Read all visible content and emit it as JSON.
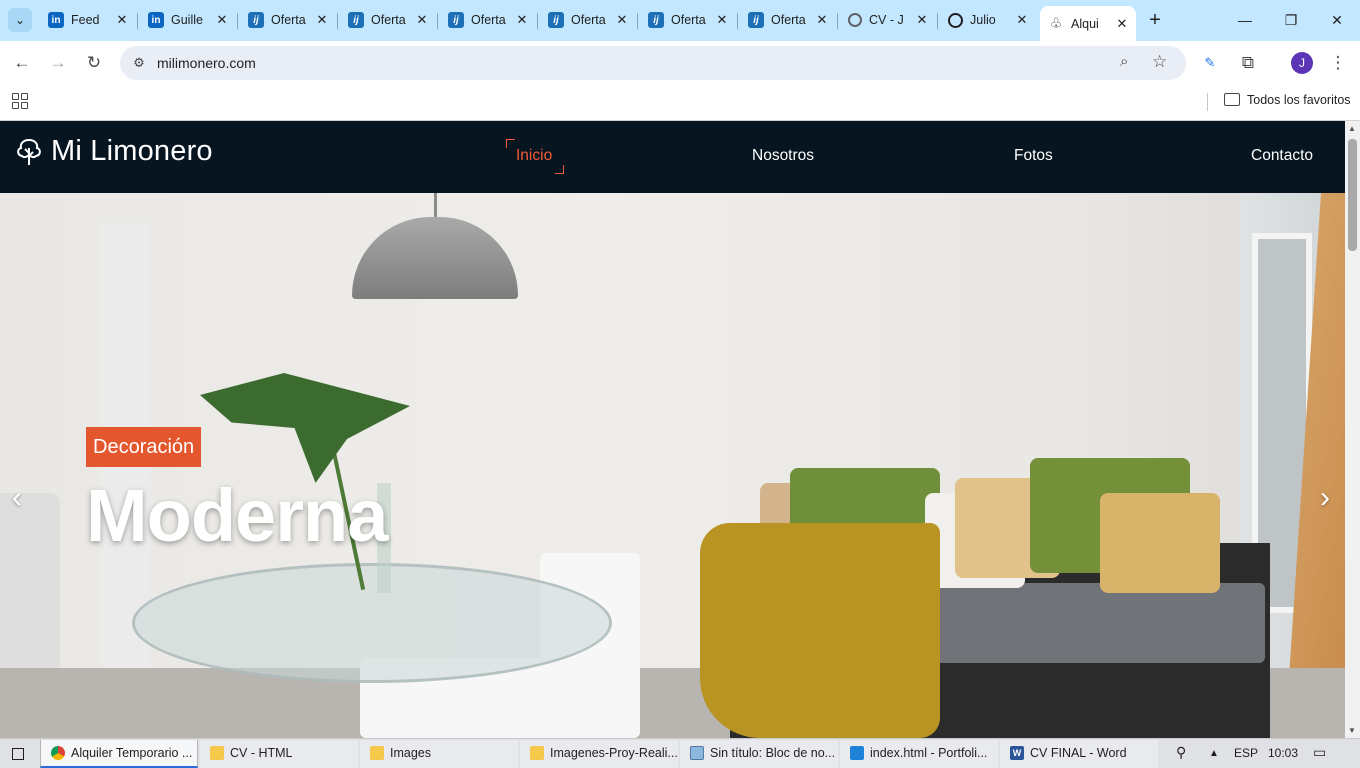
{
  "browser": {
    "tabs": [
      {
        "label": "Feed",
        "icon": "linkedin-icon"
      },
      {
        "label": "Guille",
        "icon": "linkedin-icon"
      },
      {
        "label": "Oferta",
        "icon": "infojobs-icon"
      },
      {
        "label": "Oferta",
        "icon": "infojobs-icon"
      },
      {
        "label": "Oferta",
        "icon": "infojobs-icon"
      },
      {
        "label": "Oferta",
        "icon": "infojobs-icon"
      },
      {
        "label": "Oferta",
        "icon": "infojobs-icon"
      },
      {
        "label": "Oferta",
        "icon": "infojobs-icon"
      },
      {
        "label": "CV - J",
        "icon": "globe-icon"
      },
      {
        "label": "Julio",
        "icon": "circle-icon"
      },
      {
        "label": "Alqui",
        "icon": "tree-icon",
        "active": true
      }
    ],
    "url": "milimonero.com",
    "bookmarks": {
      "all_label": "Todos los favoritos"
    },
    "profile_initial": "J"
  },
  "site": {
    "logo_text": "Mi Limonero",
    "nav": [
      {
        "label": "Inicio",
        "active": true
      },
      {
        "label": "Nosotros"
      },
      {
        "label": "Fotos"
      },
      {
        "label": "Contacto"
      }
    ],
    "hero": {
      "badge": "Decoración",
      "title": "Moderna",
      "prev_arrow": "‹",
      "next_arrow": "›"
    },
    "accent_color": "#f05a3a",
    "nav_background": "#06151f"
  },
  "taskbar": {
    "items": [
      {
        "label": "Alquiler Temporario ...",
        "icon": "chrome-icon",
        "active": true
      },
      {
        "label": "CV - HTML",
        "icon": "folder-icon"
      },
      {
        "label": "Images",
        "icon": "folder-icon"
      },
      {
        "label": "Imagenes-Proy-Reali...",
        "icon": "folder-icon"
      },
      {
        "label": "Sin título: Bloc de no...",
        "icon": "notepad-icon"
      },
      {
        "label": "index.html - Portfoli...",
        "icon": "vscode-icon"
      },
      {
        "label": "CV FINAL - Word",
        "icon": "word-icon"
      }
    ],
    "language": "ESP",
    "time": "10:03"
  }
}
